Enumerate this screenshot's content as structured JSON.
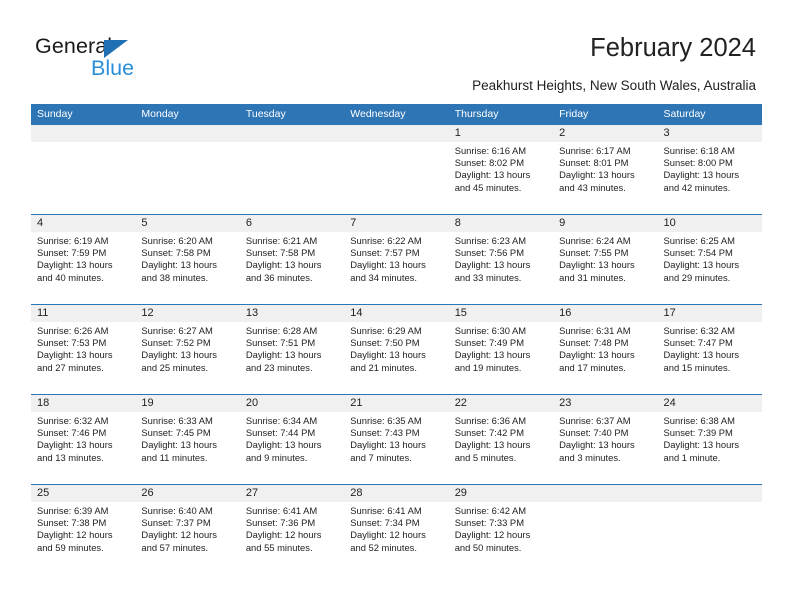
{
  "brand": {
    "name_top": "General",
    "name_bottom": "Blue",
    "triangle_color": "#1f6fb5",
    "blue_text_color": "#2a8fd8"
  },
  "header": {
    "title": "February 2024",
    "subtitle": "Peakhurst Heights, New South Wales, Australia"
  },
  "theme": {
    "header_bar_color": "#2e75b6",
    "date_band_color": "#f0f0f0",
    "week_rule_color": "#2e75b6",
    "text_color": "#222222"
  },
  "calendar": {
    "weekday_headers": [
      "Sunday",
      "Monday",
      "Tuesday",
      "Wednesday",
      "Thursday",
      "Friday",
      "Saturday"
    ],
    "weeks": [
      {
        "dates": [
          "",
          "",
          "",
          "",
          "1",
          "2",
          "3"
        ],
        "cells": [
          {
            "sunrise": "",
            "sunset": "",
            "daylight_1": "",
            "daylight_2": ""
          },
          {
            "sunrise": "",
            "sunset": "",
            "daylight_1": "",
            "daylight_2": ""
          },
          {
            "sunrise": "",
            "sunset": "",
            "daylight_1": "",
            "daylight_2": ""
          },
          {
            "sunrise": "",
            "sunset": "",
            "daylight_1": "",
            "daylight_2": ""
          },
          {
            "sunrise": "Sunrise: 6:16 AM",
            "sunset": "Sunset: 8:02 PM",
            "daylight_1": "Daylight: 13 hours",
            "daylight_2": "and 45 minutes."
          },
          {
            "sunrise": "Sunrise: 6:17 AM",
            "sunset": "Sunset: 8:01 PM",
            "daylight_1": "Daylight: 13 hours",
            "daylight_2": "and 43 minutes."
          },
          {
            "sunrise": "Sunrise: 6:18 AM",
            "sunset": "Sunset: 8:00 PM",
            "daylight_1": "Daylight: 13 hours",
            "daylight_2": "and 42 minutes."
          }
        ]
      },
      {
        "dates": [
          "4",
          "5",
          "6",
          "7",
          "8",
          "9",
          "10"
        ],
        "cells": [
          {
            "sunrise": "Sunrise: 6:19 AM",
            "sunset": "Sunset: 7:59 PM",
            "daylight_1": "Daylight: 13 hours",
            "daylight_2": "and 40 minutes."
          },
          {
            "sunrise": "Sunrise: 6:20 AM",
            "sunset": "Sunset: 7:58 PM",
            "daylight_1": "Daylight: 13 hours",
            "daylight_2": "and 38 minutes."
          },
          {
            "sunrise": "Sunrise: 6:21 AM",
            "sunset": "Sunset: 7:58 PM",
            "daylight_1": "Daylight: 13 hours",
            "daylight_2": "and 36 minutes."
          },
          {
            "sunrise": "Sunrise: 6:22 AM",
            "sunset": "Sunset: 7:57 PM",
            "daylight_1": "Daylight: 13 hours",
            "daylight_2": "and 34 minutes."
          },
          {
            "sunrise": "Sunrise: 6:23 AM",
            "sunset": "Sunset: 7:56 PM",
            "daylight_1": "Daylight: 13 hours",
            "daylight_2": "and 33 minutes."
          },
          {
            "sunrise": "Sunrise: 6:24 AM",
            "sunset": "Sunset: 7:55 PM",
            "daylight_1": "Daylight: 13 hours",
            "daylight_2": "and 31 minutes."
          },
          {
            "sunrise": "Sunrise: 6:25 AM",
            "sunset": "Sunset: 7:54 PM",
            "daylight_1": "Daylight: 13 hours",
            "daylight_2": "and 29 minutes."
          }
        ]
      },
      {
        "dates": [
          "11",
          "12",
          "13",
          "14",
          "15",
          "16",
          "17"
        ],
        "cells": [
          {
            "sunrise": "Sunrise: 6:26 AM",
            "sunset": "Sunset: 7:53 PM",
            "daylight_1": "Daylight: 13 hours",
            "daylight_2": "and 27 minutes."
          },
          {
            "sunrise": "Sunrise: 6:27 AM",
            "sunset": "Sunset: 7:52 PM",
            "daylight_1": "Daylight: 13 hours",
            "daylight_2": "and 25 minutes."
          },
          {
            "sunrise": "Sunrise: 6:28 AM",
            "sunset": "Sunset: 7:51 PM",
            "daylight_1": "Daylight: 13 hours",
            "daylight_2": "and 23 minutes."
          },
          {
            "sunrise": "Sunrise: 6:29 AM",
            "sunset": "Sunset: 7:50 PM",
            "daylight_1": "Daylight: 13 hours",
            "daylight_2": "and 21 minutes."
          },
          {
            "sunrise": "Sunrise: 6:30 AM",
            "sunset": "Sunset: 7:49 PM",
            "daylight_1": "Daylight: 13 hours",
            "daylight_2": "and 19 minutes."
          },
          {
            "sunrise": "Sunrise: 6:31 AM",
            "sunset": "Sunset: 7:48 PM",
            "daylight_1": "Daylight: 13 hours",
            "daylight_2": "and 17 minutes."
          },
          {
            "sunrise": "Sunrise: 6:32 AM",
            "sunset": "Sunset: 7:47 PM",
            "daylight_1": "Daylight: 13 hours",
            "daylight_2": "and 15 minutes."
          }
        ]
      },
      {
        "dates": [
          "18",
          "19",
          "20",
          "21",
          "22",
          "23",
          "24"
        ],
        "cells": [
          {
            "sunrise": "Sunrise: 6:32 AM",
            "sunset": "Sunset: 7:46 PM",
            "daylight_1": "Daylight: 13 hours",
            "daylight_2": "and 13 minutes."
          },
          {
            "sunrise": "Sunrise: 6:33 AM",
            "sunset": "Sunset: 7:45 PM",
            "daylight_1": "Daylight: 13 hours",
            "daylight_2": "and 11 minutes."
          },
          {
            "sunrise": "Sunrise: 6:34 AM",
            "sunset": "Sunset: 7:44 PM",
            "daylight_1": "Daylight: 13 hours",
            "daylight_2": "and 9 minutes."
          },
          {
            "sunrise": "Sunrise: 6:35 AM",
            "sunset": "Sunset: 7:43 PM",
            "daylight_1": "Daylight: 13 hours",
            "daylight_2": "and 7 minutes."
          },
          {
            "sunrise": "Sunrise: 6:36 AM",
            "sunset": "Sunset: 7:42 PM",
            "daylight_1": "Daylight: 13 hours",
            "daylight_2": "and 5 minutes."
          },
          {
            "sunrise": "Sunrise: 6:37 AM",
            "sunset": "Sunset: 7:40 PM",
            "daylight_1": "Daylight: 13 hours",
            "daylight_2": "and 3 minutes."
          },
          {
            "sunrise": "Sunrise: 6:38 AM",
            "sunset": "Sunset: 7:39 PM",
            "daylight_1": "Daylight: 13 hours",
            "daylight_2": "and 1 minute."
          }
        ]
      },
      {
        "dates": [
          "25",
          "26",
          "27",
          "28",
          "29",
          "",
          ""
        ],
        "cells": [
          {
            "sunrise": "Sunrise: 6:39 AM",
            "sunset": "Sunset: 7:38 PM",
            "daylight_1": "Daylight: 12 hours",
            "daylight_2": "and 59 minutes."
          },
          {
            "sunrise": "Sunrise: 6:40 AM",
            "sunset": "Sunset: 7:37 PM",
            "daylight_1": "Daylight: 12 hours",
            "daylight_2": "and 57 minutes."
          },
          {
            "sunrise": "Sunrise: 6:41 AM",
            "sunset": "Sunset: 7:36 PM",
            "daylight_1": "Daylight: 12 hours",
            "daylight_2": "and 55 minutes."
          },
          {
            "sunrise": "Sunrise: 6:41 AM",
            "sunset": "Sunset: 7:34 PM",
            "daylight_1": "Daylight: 12 hours",
            "daylight_2": "and 52 minutes."
          },
          {
            "sunrise": "Sunrise: 6:42 AM",
            "sunset": "Sunset: 7:33 PM",
            "daylight_1": "Daylight: 12 hours",
            "daylight_2": "and 50 minutes."
          },
          {
            "sunrise": "",
            "sunset": "",
            "daylight_1": "",
            "daylight_2": ""
          },
          {
            "sunrise": "",
            "sunset": "",
            "daylight_1": "",
            "daylight_2": ""
          }
        ]
      }
    ]
  }
}
